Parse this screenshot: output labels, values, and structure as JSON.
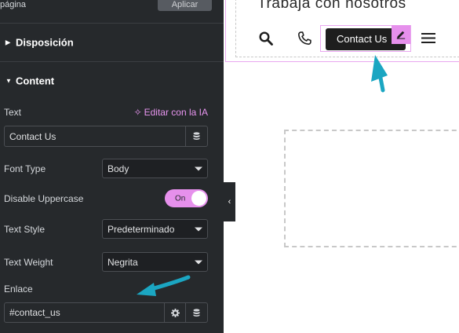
{
  "panel": {
    "page_label": "página",
    "apply_label": "Aplicar",
    "sections": {
      "layout": "Disposición",
      "content": "Content"
    },
    "text": {
      "label": "Text",
      "ai_label": "Editar con la IA",
      "value": "Contact Us"
    },
    "font_type": {
      "label": "Font Type",
      "value": "Body"
    },
    "disable_uppercase": {
      "label": "Disable Uppercase",
      "state": "On"
    },
    "text_style": {
      "label": "Text Style",
      "value": "Predeterminado"
    },
    "text_weight": {
      "label": "Text Weight",
      "value": "Negrita"
    },
    "link": {
      "label": "Enlace",
      "value": "#contact_us"
    }
  },
  "canvas": {
    "career_link": "Trabaja con nosotros",
    "contact_button": "Contact Us"
  },
  "colors": {
    "panel_bg": "#26292c",
    "accent_pink": "#e690ec",
    "arrow_cyan": "#1ba6c2"
  },
  "icons": [
    "chevron-right-icon",
    "chevron-down-icon",
    "sparkle-icon",
    "database-icon",
    "gear-icon",
    "search-icon",
    "phone-icon",
    "pencil-icon",
    "hamburger-menu-icon",
    "chevron-left-icon"
  ]
}
